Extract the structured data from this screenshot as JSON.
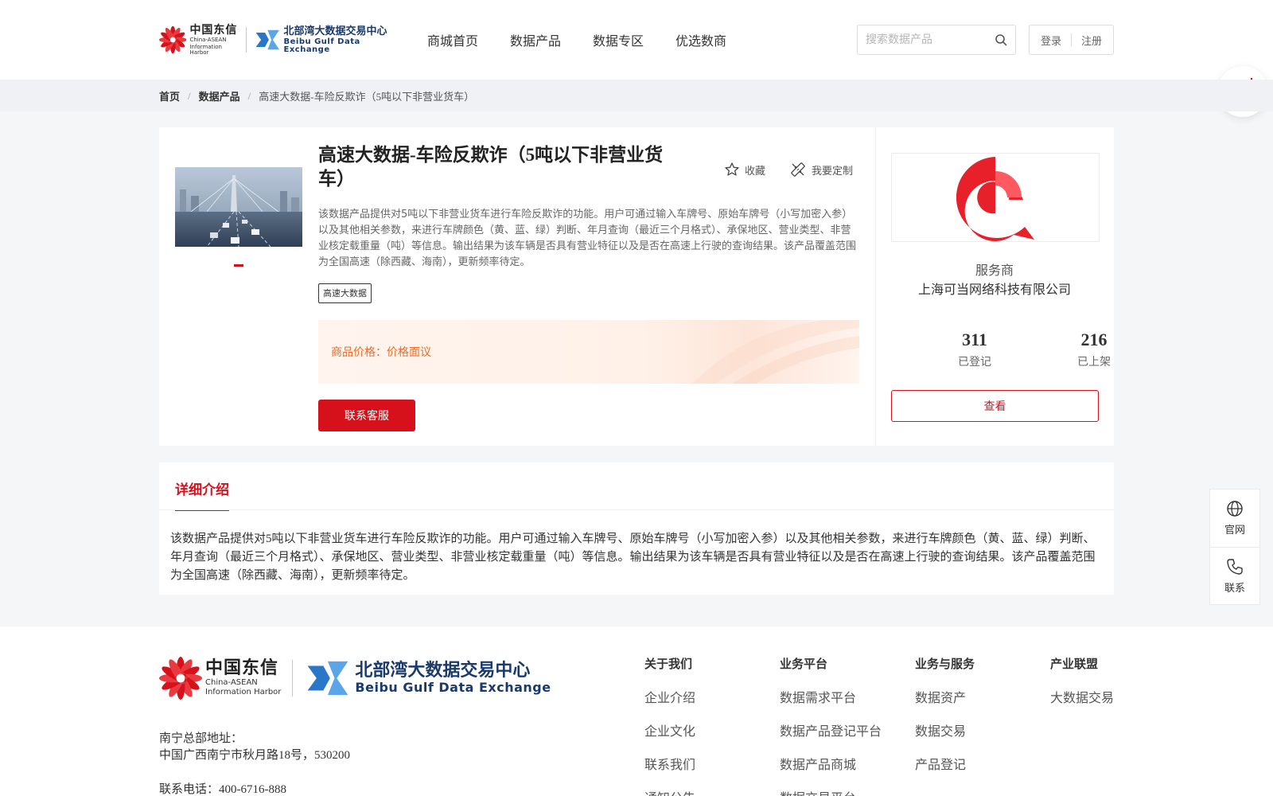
{
  "header": {
    "logo_cn_main": "中国东信",
    "logo_cn_sub1": "China-ASEAN",
    "logo_cn_sub2": "Information Harbor",
    "logo_bg_main": "北部湾大数据交易中心",
    "logo_bg_sub": "Beibu Gulf Data Exchange",
    "nav": [
      "商城首页",
      "数据产品",
      "数据专区",
      "优选数商"
    ],
    "search_placeholder": "搜索数据产品",
    "login": "登录",
    "register": "注册"
  },
  "breadcrumb": [
    "首页",
    "数据产品",
    "高速大数据-车险反欺诈（5吨以下非营业货车）"
  ],
  "product": {
    "title": "高速大数据-车险反欺诈（5吨以下非营业货车）",
    "favorite": "收藏",
    "customize": "我要定制",
    "description": "该数据产品提供对5吨以下非营业货车进行车险反欺诈的功能。用户可通过输入车牌号、原始车牌号（小写加密入参）以及其他相关参数，来进行车牌颜色（黄、蓝、绿）判断、年月查询（最近三个月格式）、承保地区、营业类型、非营业核定载重量（吨）等信息。输出结果为该车辆是否具有营业特征以及是否在高速上行驶的查询结果。该产品覆盖范围为全国高速（除西藏、海南），更新频率待定。",
    "tag": "高速大数据",
    "price_label": "商品价格：",
    "price_value": "价格面议",
    "contact_button": "联系客服"
  },
  "vendor": {
    "label": "服务商",
    "name": "上海可当网络科技有限公司",
    "registered_count": "311",
    "registered_label": "已登记",
    "listed_count": "216",
    "listed_label": "已上架",
    "view_button": "查看"
  },
  "detail": {
    "tab": "详细介绍",
    "text": "该数据产品提供对5吨以下非营业货车进行车险反欺诈的功能。用户可通过输入车牌号、原始车牌号（小写加密入参）以及其他相关参数，来进行车牌颜色（黄、蓝、绿）判断、年月查询（最近三个月格式）、承保地区、营业类型、非营业核定载重量（吨）等信息。输出结果为该车辆是否具有营业特征以及是否在高速上行驶的查询结果。该产品覆盖范围为全国高速（除西藏、海南），更新频率待定。"
  },
  "side": {
    "website": "官网",
    "contact": "联系"
  },
  "footer": {
    "address_label": "南宁总部地址：",
    "address": "中国广西南宁市秋月路18号，530200",
    "phone": "联系电话：400-6716-888",
    "columns": [
      {
        "heading": "关于我们",
        "links": [
          "企业介绍",
          "企业文化",
          "联系我们",
          "通知公告"
        ]
      },
      {
        "heading": "业务平台",
        "links": [
          "数据需求平台",
          "数据产品登记平台",
          "数据产品商城",
          "数据交易平台"
        ]
      },
      {
        "heading": "业务与服务",
        "links": [
          "数据资产",
          "数据交易",
          "产品登记"
        ]
      },
      {
        "heading": "产业联盟",
        "links": [
          "大数据交易"
        ]
      }
    ]
  },
  "colors": {
    "brand_red": "#d7111c",
    "price_orange": "#ef6b23",
    "logo_blue": "#1a3a6b"
  }
}
